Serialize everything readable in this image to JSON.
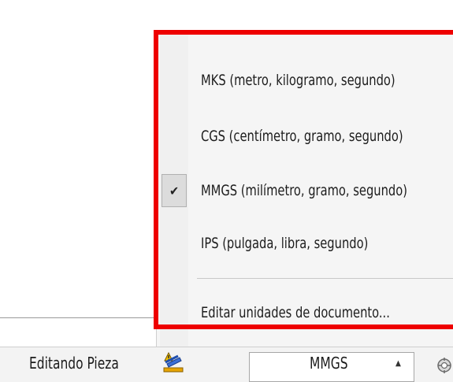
{
  "units_menu": {
    "items": [
      {
        "label": "MKS (metro, kilogramo, segundo)",
        "checked": false
      },
      {
        "label": "CGS (centímetro, gramo, segundo)",
        "checked": false
      },
      {
        "label": "MMGS (milímetro, gramo, segundo)",
        "checked": true
      },
      {
        "label": "IPS (pulgada, libra, segundo)",
        "checked": false
      }
    ],
    "edit_label": "Editar unidades de documento...",
    "check_glyph": "✔"
  },
  "status_bar": {
    "status_text": "Editando Pieza",
    "rebuild_icon": "rebuild-warning-icon",
    "units_select": {
      "value": "MMGS",
      "arrow_glyph": "▲"
    },
    "trailing_icon": "settings-icon"
  },
  "colors": {
    "highlight": "#ee0000",
    "menu_background": "#f5f5f5",
    "status_bar": "#f3f3f3"
  }
}
